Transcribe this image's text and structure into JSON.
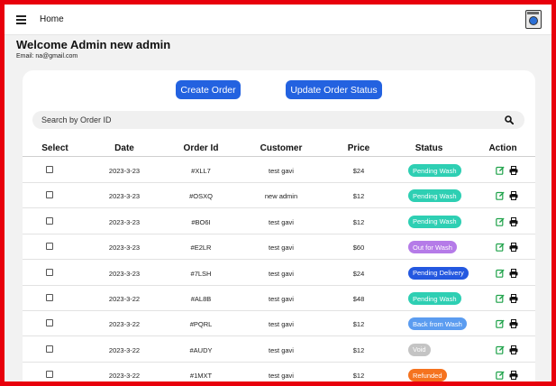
{
  "header": {
    "title": "Home"
  },
  "welcome": {
    "heading": "Welcome Admin new admin",
    "email": "Email: na@gmail.com"
  },
  "actions": {
    "create_label": "Create Order",
    "update_label": "Update Order Status"
  },
  "search": {
    "placeholder": "Search by Order ID"
  },
  "table": {
    "columns": [
      "Select",
      "Date",
      "Order Id",
      "Customer",
      "Price",
      "Status",
      "Action"
    ],
    "rows": [
      {
        "date": "2023-3-23",
        "order_id": "#XLL7",
        "customer": "test gavi",
        "price": "$24",
        "status": "Pending Wash",
        "status_color": "#2ecfb3"
      },
      {
        "date": "2023-3-23",
        "order_id": "#OSXQ",
        "customer": "new admin",
        "price": "$12",
        "status": "Pending Wash",
        "status_color": "#2ecfb3"
      },
      {
        "date": "2023-3-23",
        "order_id": "#BO6I",
        "customer": "test gavi",
        "price": "$12",
        "status": "Pending Wash",
        "status_color": "#2ecfb3"
      },
      {
        "date": "2023-3-23",
        "order_id": "#E2LR",
        "customer": "test gavi",
        "price": "$60",
        "status": "Out for Wash",
        "status_color": "#b57be8"
      },
      {
        "date": "2023-3-23",
        "order_id": "#7LSH",
        "customer": "test gavi",
        "price": "$24",
        "status": "Pending Delivery",
        "status_color": "#2458e0"
      },
      {
        "date": "2023-3-22",
        "order_id": "#AL8B",
        "customer": "test gavi",
        "price": "$48",
        "status": "Pending Wash",
        "status_color": "#2ecfb3"
      },
      {
        "date": "2023-3-22",
        "order_id": "#PQRL",
        "customer": "test gavi",
        "price": "$12",
        "status": "Back from Wash",
        "status_color": "#5b9cf0"
      },
      {
        "date": "2023-3-22",
        "order_id": "#AUDY",
        "customer": "test gavi",
        "price": "$12",
        "status": "Void",
        "status_color": "#c4c4c4"
      },
      {
        "date": "2023-3-22",
        "order_id": "#1MXT",
        "customer": "test gavi",
        "price": "$12",
        "status": "Refunded",
        "status_color": "#f5731f"
      }
    ]
  },
  "colors": {
    "frame": "#e8000c",
    "primary": "#2362e0",
    "edit_icon": "#1fa24a"
  }
}
